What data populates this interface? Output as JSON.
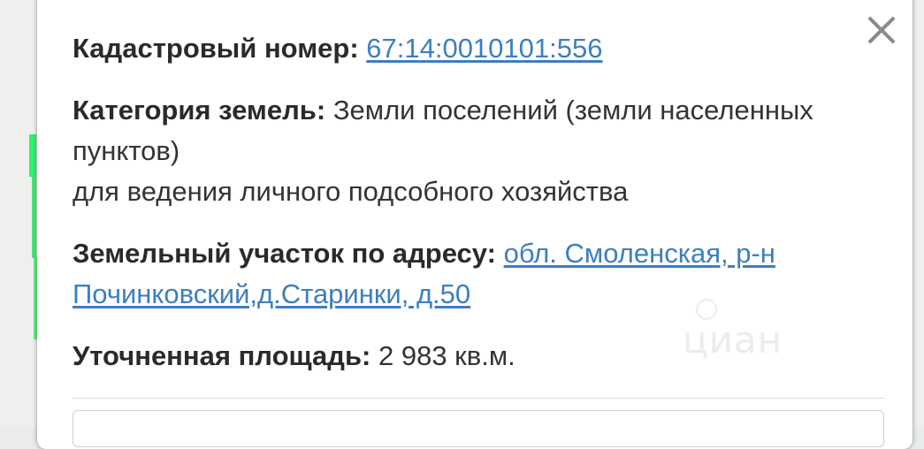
{
  "popup": {
    "cadastral": {
      "label": "Кадастровый номер:",
      "value": "67:14:0010101:556"
    },
    "category": {
      "label": "Категория земель:",
      "value_line1": "Земли поселений (земли населенных",
      "value_line2": "пунктов)",
      "purpose": "для ведения личного подсобного хозяйства"
    },
    "address": {
      "label": "Земельный участок по адресу:",
      "value_line1": "обл. Смоленская, р-н",
      "value_line2": "Починковский,д.Старинки, д.50"
    },
    "area": {
      "label": "Уточненная площадь:",
      "value": "2 983 кв.м."
    },
    "close_icon": "close-icon"
  },
  "watermark": {
    "text": "циан"
  },
  "colors": {
    "link": "#3d7fbe",
    "route_line": "#2ef26a",
    "close_icon": "#8a8a8a"
  }
}
